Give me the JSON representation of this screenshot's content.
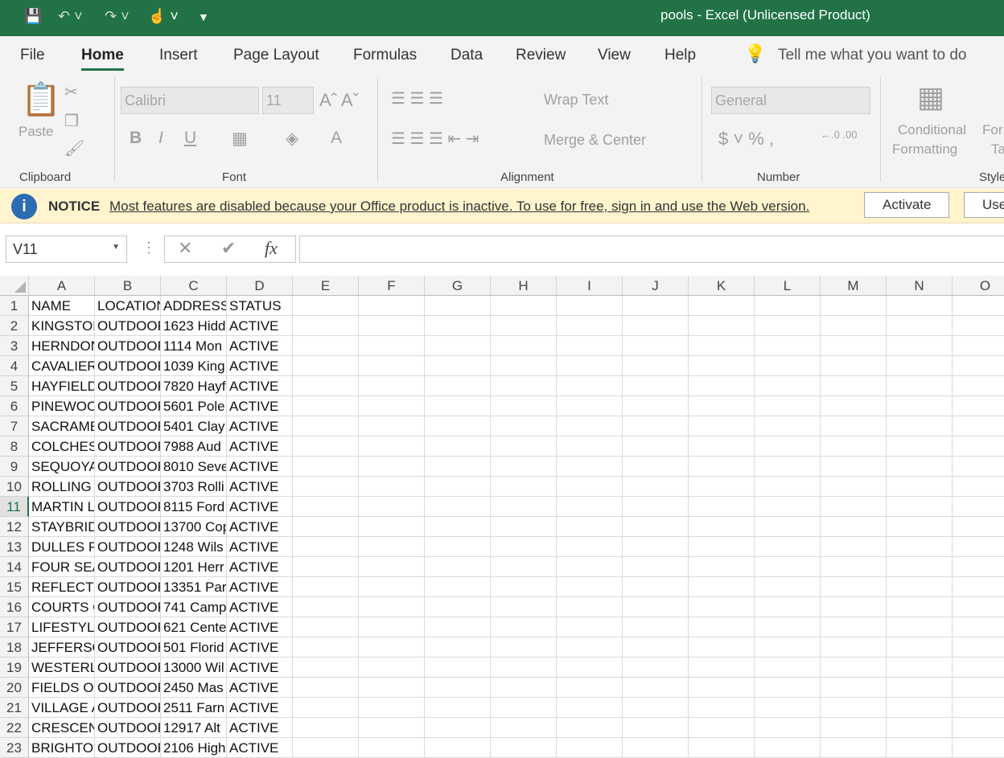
{
  "titlebar": {
    "title": "pools  -  Excel (Unlicensed Product)"
  },
  "tabs": [
    "File",
    "Home",
    "Insert",
    "Page Layout",
    "Formulas",
    "Data",
    "Review",
    "View",
    "Help"
  ],
  "tell_me": "Tell me what you want to do",
  "ribbon": {
    "paste": "Paste",
    "clipboard": "Clipboard",
    "font": "Font",
    "alignment": "Alignment",
    "number": "Number",
    "styles": "Style",
    "font_name": "Calibri",
    "font_size": "11",
    "wrap_text": "Wrap Text",
    "merge_center": "Merge & Center",
    "number_format": "General",
    "conditional": "Conditional",
    "formatting": "Formatting",
    "format_as": "For",
    "table": "Ta"
  },
  "notice": {
    "label": "NOTICE",
    "message": "Most features are disabled because your Office product is inactive. To use for free, sign in and use the Web version.",
    "activate": "Activate",
    "use": "Use"
  },
  "formula_bar": {
    "name_box": "V11",
    "value": ""
  },
  "columns": [
    "A",
    "B",
    "C",
    "D",
    "E",
    "F",
    "G",
    "H",
    "I",
    "J",
    "K",
    "L",
    "M",
    "N",
    "O"
  ],
  "selected_row": 11,
  "rows": [
    [
      "NAME",
      "LOCATION",
      "ADDRESS",
      "STATUS"
    ],
    [
      "KINGSTON",
      "OUTDOOR",
      "1623 Hidd",
      "ACTIVE"
    ],
    [
      "HERNDON",
      "OUTDOOR",
      "1114 Mon",
      "ACTIVE"
    ],
    [
      "CAVALIER",
      "OUTDOOR",
      "1039 King",
      "ACTIVE"
    ],
    [
      "HAYFIELD",
      "OUTDOOR",
      "7820 Hayf",
      "ACTIVE"
    ],
    [
      "PINEWOO",
      "OUTDOOR",
      "5601 Pole",
      "ACTIVE"
    ],
    [
      "SACRAME",
      "OUTDOOR",
      "5401 Clay",
      "ACTIVE"
    ],
    [
      "COLCHEST",
      "OUTDOOR",
      "7988 Aud",
      "ACTIVE"
    ],
    [
      "SEQUOYA",
      "OUTDOOR",
      "8010 Seve",
      "ACTIVE"
    ],
    [
      "ROLLING H",
      "OUTDOOR",
      "3703 Rolli",
      "ACTIVE"
    ],
    [
      "MARTIN L",
      "OUTDOOR",
      "8115 Ford",
      "ACTIVE"
    ],
    [
      "STAYBRID",
      "OUTDOOR",
      "13700 Cop",
      "ACTIVE"
    ],
    [
      "DULLES PA",
      "OUTDOOR",
      "1248 Wils",
      "ACTIVE"
    ],
    [
      "FOUR SEA",
      "OUTDOOR",
      "1201 Herr",
      "ACTIVE"
    ],
    [
      "REFLECTIO",
      "OUTDOOR",
      "13351 Par",
      "ACTIVE"
    ],
    [
      "COURTS O",
      "OUTDOOR",
      "741 Camp",
      "ACTIVE"
    ],
    [
      "LIFESTYLE",
      "OUTDOOR",
      "621 Cente",
      "ACTIVE"
    ],
    [
      "JEFFERSON",
      "OUTDOOR",
      "501 Florid",
      "ACTIVE"
    ],
    [
      "WESTERLY",
      "OUTDOOR",
      "13000 Wil",
      "ACTIVE"
    ],
    [
      "FIELDS OF",
      "OUTDOOR",
      "2450 Mas",
      "ACTIVE"
    ],
    [
      "VILLAGE A",
      "OUTDOOR",
      "2511 Farn",
      "ACTIVE"
    ],
    [
      "CRESCENT",
      "OUTDOOR",
      "12917 Alt",
      "ACTIVE"
    ],
    [
      "BRIGHTON",
      "OUTDOOR",
      "2106 High",
      "ACTIVE"
    ]
  ]
}
